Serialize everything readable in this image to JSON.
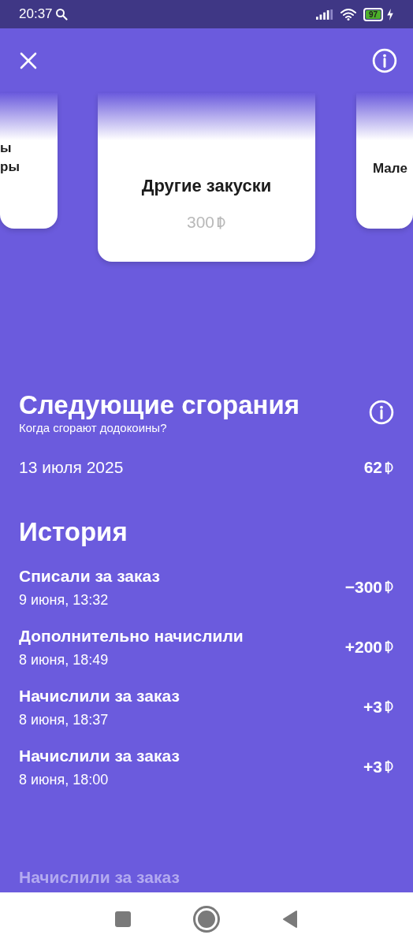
{
  "status_bar": {
    "time": "20:37",
    "battery": "97"
  },
  "cards": [
    {
      "kind": "left",
      "lines": [
        "ы",
        "ры"
      ]
    },
    {
      "kind": "center",
      "lines": [
        "Другие закуски"
      ],
      "price": "300"
    },
    {
      "kind": "right",
      "lines": [
        "Мале"
      ]
    }
  ],
  "expirations": {
    "title": "Следующие сгорания",
    "subtitle": "Когда сгорают додокоины?",
    "items": [
      {
        "date": "13 июля 2025",
        "amount": "62"
      }
    ]
  },
  "history": {
    "title": "История",
    "items": [
      {
        "title": "Списали за заказ",
        "date": "9 июня, 13:32",
        "amount": "−300"
      },
      {
        "title": "Дополнительно начислили",
        "date": "8 июня, 18:49",
        "amount": "+200"
      },
      {
        "title": "Начислили за заказ",
        "date": "8 июня, 18:37",
        "amount": "+3"
      },
      {
        "title": "Начислили за заказ",
        "date": "8 июня, 18:00",
        "amount": "+3"
      }
    ],
    "faded_item": "Начислили за заказ"
  }
}
